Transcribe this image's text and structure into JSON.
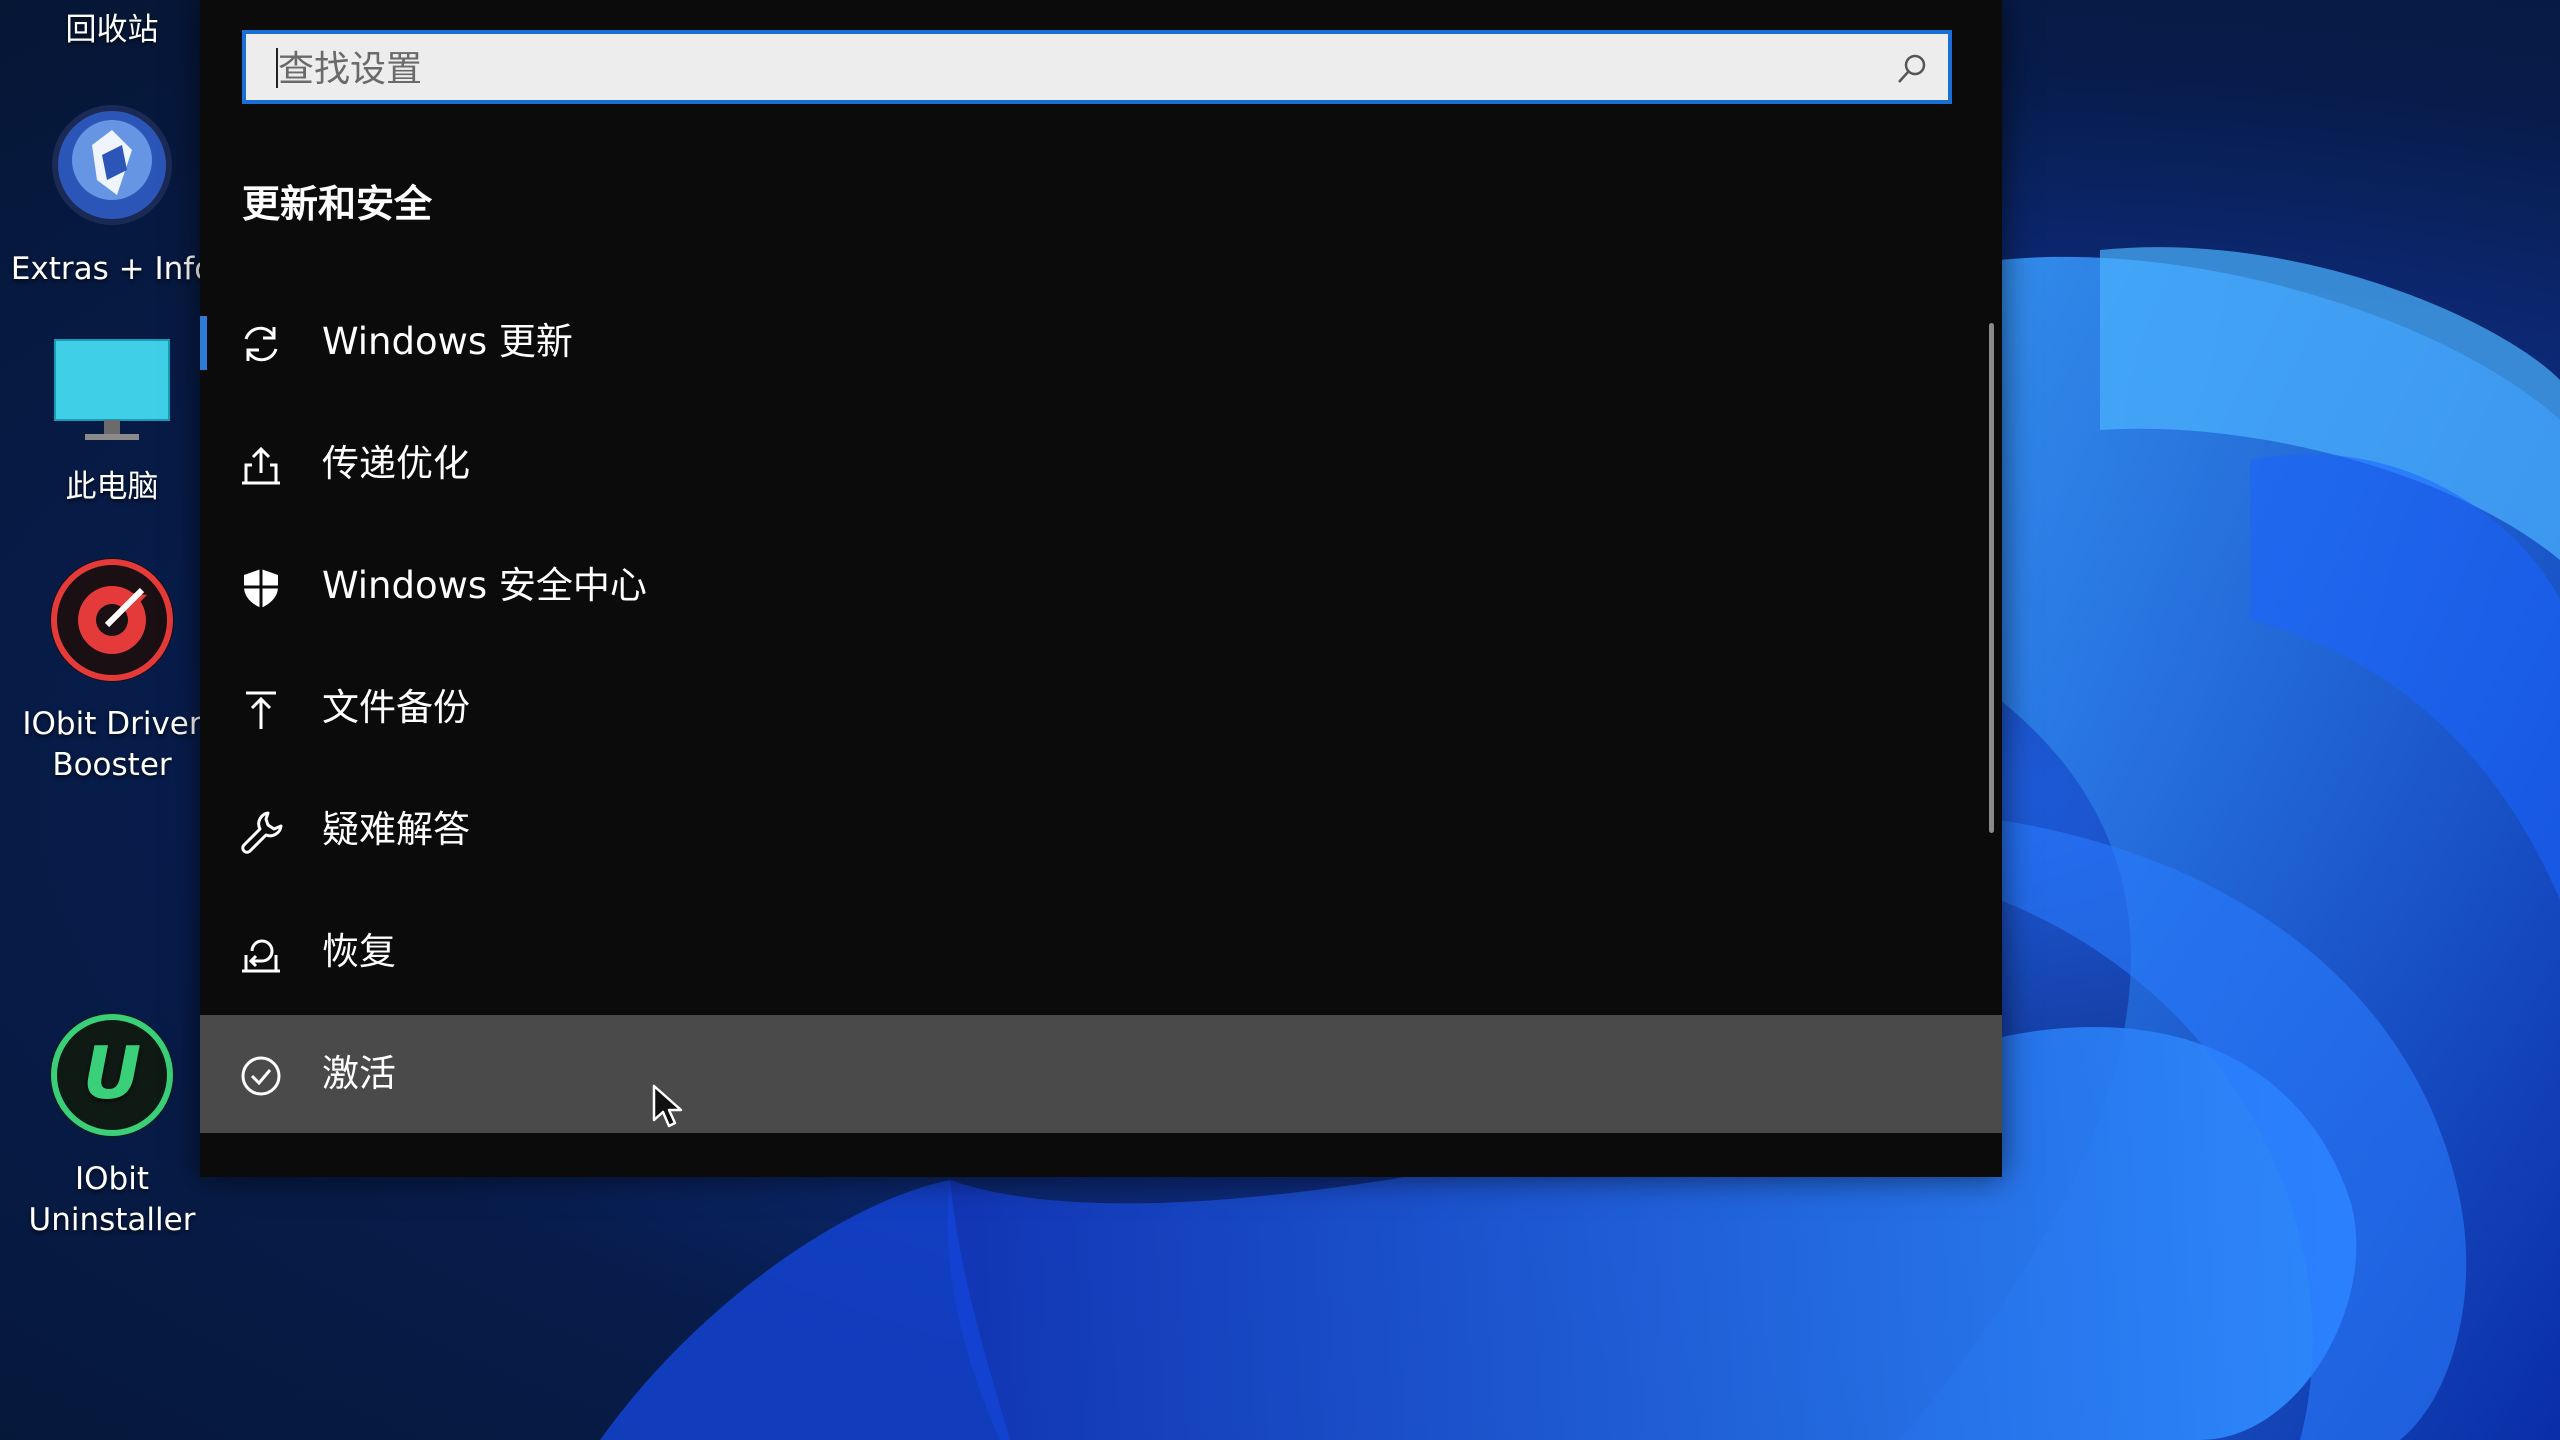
{
  "desktop": {
    "recycle_bin": "回收站",
    "extras_info": "Extras + Info",
    "this_pc": "此电脑",
    "driver_booster_line1": "IObit Driver",
    "driver_booster_line2": "Booster",
    "uninstaller_line1": "IObit",
    "uninstaller_line2": "Uninstaller"
  },
  "settings": {
    "search": {
      "placeholder": "查找设置",
      "value": ""
    },
    "section_title": "更新和安全",
    "items": [
      {
        "label": "Windows 更新",
        "icon": "sync-icon",
        "selected": true
      },
      {
        "label": "传递优化",
        "icon": "delivery-optimization-icon"
      },
      {
        "label": "Windows 安全中心",
        "icon": "shield-icon"
      },
      {
        "label": "文件备份",
        "icon": "backup-arrow-icon"
      },
      {
        "label": "疑难解答",
        "icon": "wrench-icon"
      },
      {
        "label": "恢复",
        "icon": "recovery-icon"
      },
      {
        "label": "激活",
        "icon": "check-circle-icon",
        "hovered": true
      }
    ]
  },
  "colors": {
    "accent": "#1a6fd6",
    "panel_bg": "#0b0b0c",
    "hover_bg": "#4a4a4a",
    "selected_bar": "#2f7ad6"
  }
}
